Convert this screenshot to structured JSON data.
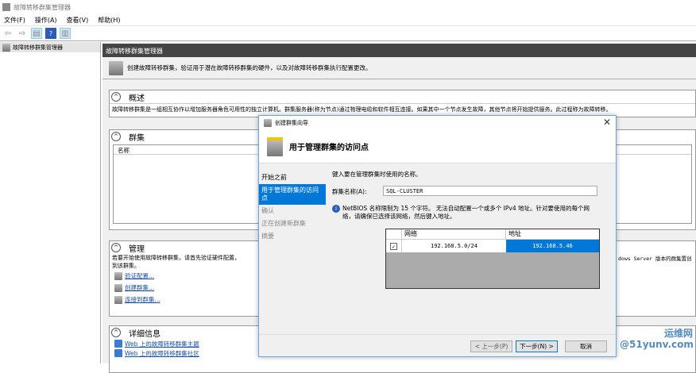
{
  "window": {
    "title": "故障转移群集管理器"
  },
  "menu": [
    "文件(F)",
    "操作(A)",
    "查看(V)",
    "帮助(H)"
  ],
  "tree": {
    "root": "故障转移群集管理器"
  },
  "main": {
    "header": "故障转移群集管理器",
    "description": "创建故障转移群集，验证用于潜在故障转移群集的硬件，以及对故障转移群集执行配置更改。",
    "overview": {
      "title": "概述",
      "text": "故障转移群集是一组相互协作以增加服务器角色可用性的独立计算机。群集服务器(称为节点)通过物理电缆和软件相互连接。如果其中一个节点发生故障，其他节点将开始提供服务。此过程称为故障转移。"
    },
    "clusters": {
      "title": "群集",
      "column": "名称"
    },
    "management": {
      "title": "管理",
      "text": "若要开始使用故障转移群集，请首先验证硬件配置，",
      "text2": "到该群集。",
      "text_right": "dows Server 版本的群集置创",
      "links": [
        "验证配置...",
        "创建群集...",
        "连接到群集..."
      ]
    },
    "details": {
      "title": "详细信息",
      "links": [
        "Web 上的故障转移群集主题",
        "Web 上的故障转移群集社区"
      ]
    }
  },
  "dialog": {
    "title": "创建群集向导",
    "heading": "用于管理群集的访问点",
    "nav": [
      "开始之前",
      "用于管理群集的访问点",
      "确认",
      "正在创建新群集",
      "摘要"
    ],
    "prompt": "键入要在管理群集时使用的名称。",
    "name_label": "群集名称(A):",
    "name_value": "SQL-CLUSTER",
    "info": "NetBIOS 名称限制为 15 个字符。 无法自动配置一个或多个 IPv4 地址。针对要使用的每个网络，请确保已选择该网络，然后键入地址。",
    "grid": {
      "columns": [
        "网络",
        "地址"
      ],
      "rows": [
        {
          "checked": true,
          "network": "192.168.5.0/24",
          "address": "192.168.5.46"
        }
      ]
    },
    "buttons": {
      "back": "< 上一步(P)",
      "next": "下一步(N) >",
      "cancel": "取消"
    }
  },
  "watermark": "运维网 @51yunv.com",
  "colors": {
    "accent": "#0078d7",
    "header": "#444444"
  }
}
